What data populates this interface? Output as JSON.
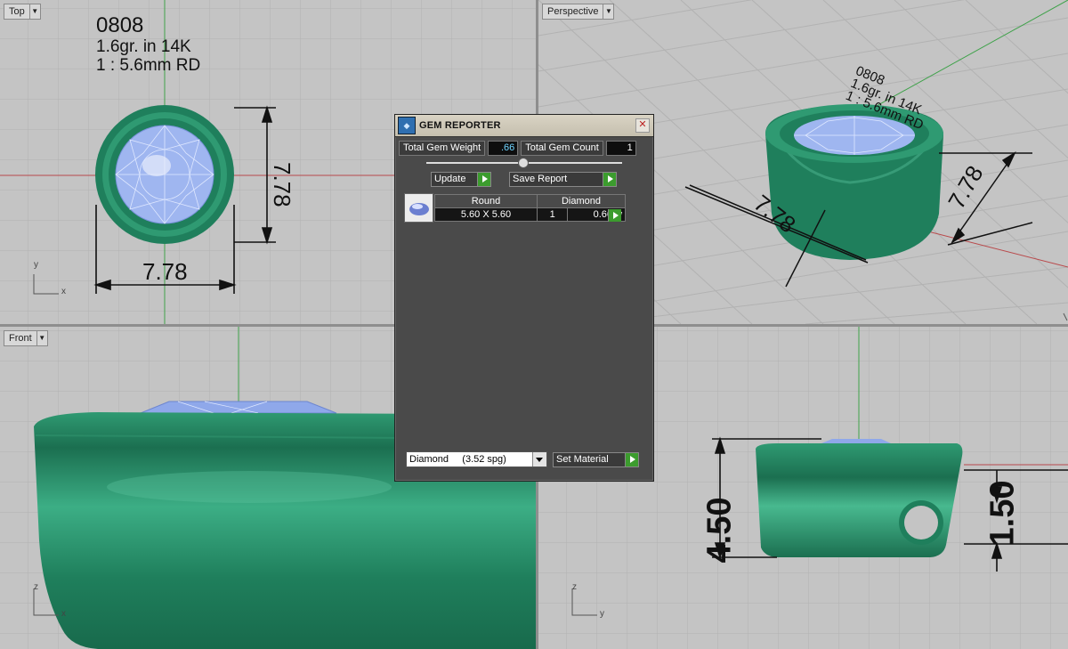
{
  "viewports": {
    "top": {
      "label": "Top",
      "notes": [
        "0808",
        "1.6gr.  in 14K",
        "1 : 5.6mm RD"
      ],
      "dims": [
        "7.78",
        "7.78"
      ],
      "axis": [
        "y",
        "x"
      ]
    },
    "perspective": {
      "label": "Perspective",
      "notes": [
        "0808",
        "1.6gr.  in 14K",
        "1 : 5.6mm RD"
      ],
      "dims": [
        "7.78",
        "7.78"
      ]
    },
    "front": {
      "label": "Front",
      "axis": [
        "z",
        "x"
      ]
    },
    "right": {
      "dims": [
        "4.50",
        "1.50"
      ],
      "axis": [
        "z",
        "y"
      ]
    }
  },
  "dialog": {
    "title": "GEM REPORTER",
    "total_weight_label": "Total Gem Weight",
    "total_weight_value": ".66",
    "total_count_label": "Total Gem Count",
    "total_count_value": "1",
    "update_label": "Update",
    "save_report_label": "Save Report",
    "table_headers": [
      "Round",
      "Diamond"
    ],
    "table_row": {
      "size": "5.60 X 5.60",
      "count": "1",
      "weight": "0.66tw"
    },
    "material": "Diamond     (3.52 spg)",
    "set_material_label": "Set Material"
  },
  "colors": {
    "metal": "#1f7f5c",
    "gem": "#8fa8ea",
    "viewport_bg": "#c4c4c4",
    "dialog_bg": "#4a4a4a",
    "accent_button": "#3c9c2e"
  }
}
